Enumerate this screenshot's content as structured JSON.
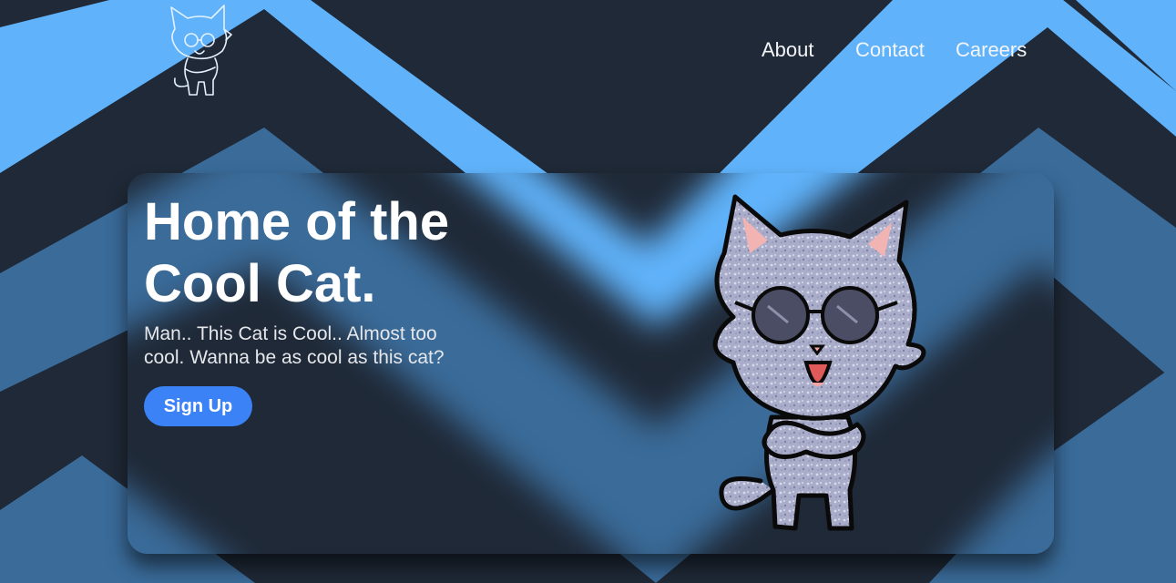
{
  "nav": {
    "items": [
      {
        "label": "About"
      },
      {
        "label": "Contact"
      },
      {
        "label": "Careers"
      }
    ]
  },
  "hero": {
    "headline_line1": "Home of the",
    "headline_line2": "Cool Cat.",
    "subtext": "Man.. This Cat is Cool.. Almost too cool. Wanna be as cool as this cat?",
    "cta_label": "Sign Up"
  },
  "images": {
    "logo": "cat-logo-outline",
    "mascot": "cool-cat-with-sunglasses"
  },
  "colors": {
    "background_dark": "#1f2937",
    "stripe_light": "#60b3fb",
    "stripe_mid": "#3a6b99",
    "button": "#3b82f6",
    "text": "#ffffff"
  }
}
